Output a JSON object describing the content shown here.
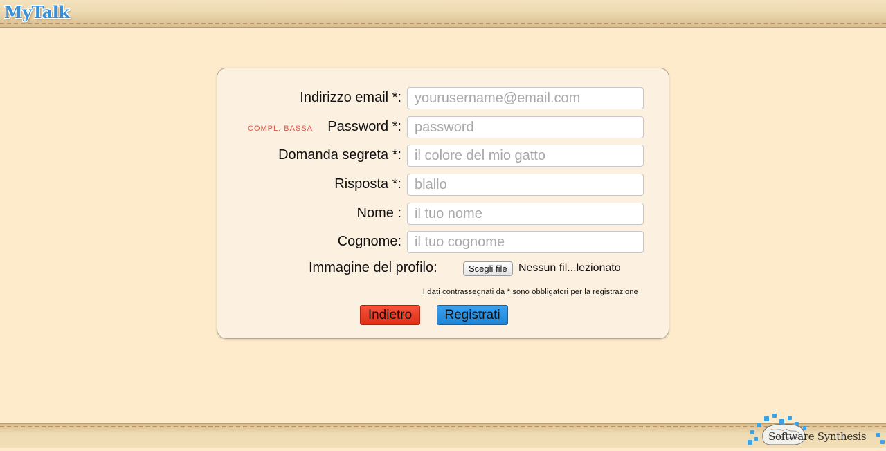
{
  "app": {
    "logo": "MyTalk"
  },
  "form": {
    "fields": [
      {
        "label": "Indirizzo email *:",
        "placeholder": "yourusername@email.com",
        "value": ""
      },
      {
        "label": "Password *:",
        "placeholder": "password",
        "value": "",
        "hint": "COMPL. BASSA"
      },
      {
        "label": "Domanda segreta *:",
        "placeholder": "il colore del mio gatto",
        "value": ""
      },
      {
        "label": "Risposta *:",
        "placeholder": "blallo",
        "value": ""
      },
      {
        "label": "Nome :",
        "placeholder": "il tuo nome",
        "value": ""
      },
      {
        "label": "Cognome:",
        "placeholder": "il tuo cognome",
        "value": ""
      }
    ],
    "file": {
      "label": "Immagine del profilo:",
      "button": "Scegli file",
      "status": "Nessun fil...lezionato"
    },
    "required_note": "I dati contrassegnati da * sono obbligatori per la registrazione",
    "buttons": {
      "back": "Indietro",
      "register": "Registrati"
    }
  },
  "footer": {
    "brand": "Software Synthesis"
  },
  "colors": {
    "background": "#fdebcb",
    "panel": "#fcf1e1",
    "back_button": "#e8391f",
    "register_button": "#2a8fe0",
    "logo": "#3b8fd6",
    "hint": "#e0524a",
    "brand_puzzle": "#3aa3e8"
  }
}
